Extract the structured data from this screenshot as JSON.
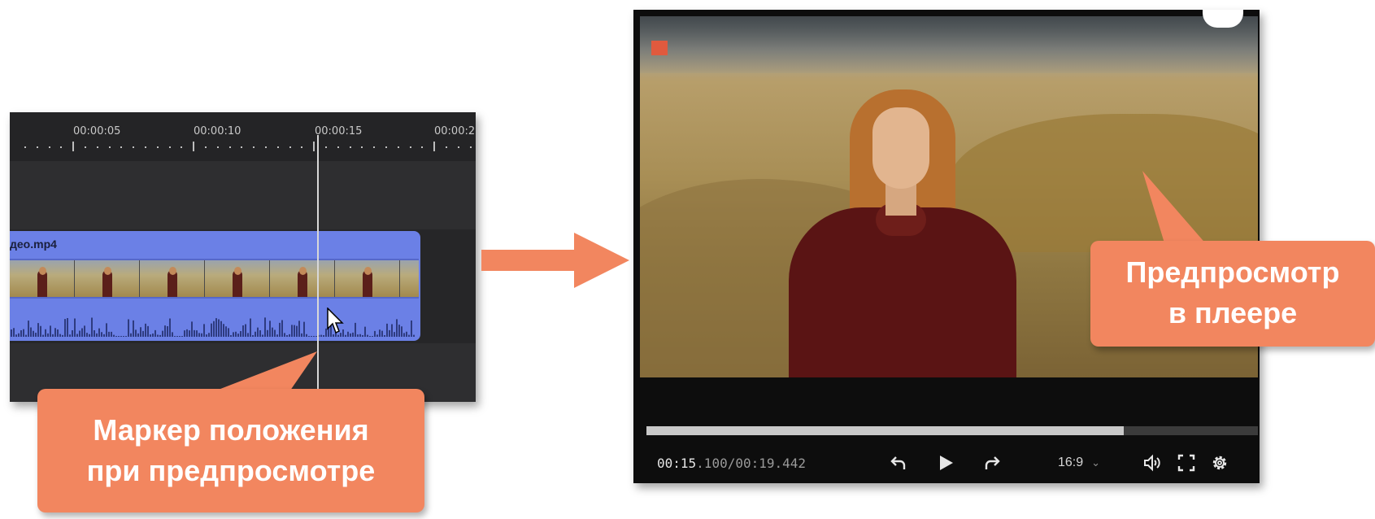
{
  "timeline": {
    "ruler_labels": [
      "00:00:05",
      "00:00:10",
      "00:00:15",
      "00:00:2"
    ],
    "clip_name": "део.mp4"
  },
  "player": {
    "time_current": "00:15",
    "time_rest": ".100/00:19.442",
    "aspect_ratio": "16:9",
    "progress_fraction": 0.78,
    "controls": [
      "undo-icon",
      "play-icon",
      "redo-icon",
      "volume-icon",
      "fullscreen-icon",
      "settings-icon"
    ]
  },
  "callouts": {
    "left_line1": "Маркер положения",
    "left_line2": "при предпросмотре",
    "right_line1": "Предпросмотр",
    "right_line2": "в плеере"
  },
  "colors": {
    "accent": "#f2865f",
    "clip": "#6b80e6",
    "record": "#e05a3e"
  }
}
